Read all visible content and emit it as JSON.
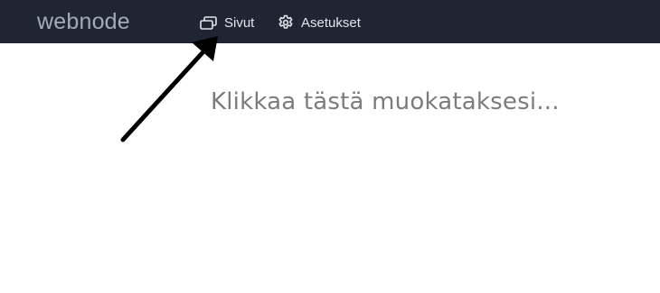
{
  "header": {
    "logo_text": "webnode",
    "nav": [
      {
        "label": "Sivut",
        "icon": "pages-icon"
      },
      {
        "label": "Asetukset",
        "icon": "gear-icon"
      }
    ]
  },
  "main": {
    "headline_placeholder": "Klikkaa tästä muokataksesi..."
  },
  "colors": {
    "topbar_bg": "#1f2533",
    "nav_text": "#e3e6ec",
    "logo": "#a4abb8",
    "headline": "#7c7c7c",
    "page_bg": "#ffffff"
  }
}
